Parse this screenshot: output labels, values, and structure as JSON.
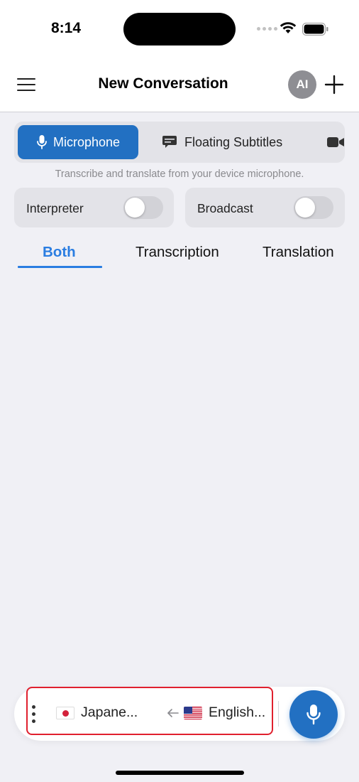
{
  "status_bar": {
    "time": "8:14"
  },
  "nav": {
    "title": "New Conversation",
    "avatar_initials": "AI",
    "menu_icon": "hamburger-menu-icon",
    "add_icon": "plus-icon"
  },
  "source_selector": {
    "items": [
      {
        "label": "Microphone",
        "icon": "microphone-icon",
        "selected": true
      },
      {
        "label": "Floating Subtitles",
        "icon": "subtitles-icon",
        "selected": false
      },
      {
        "label": "",
        "icon": "video-camera-icon",
        "selected": false
      }
    ],
    "description": "Transcribe and translate from your device microphone."
  },
  "toggles": [
    {
      "label": "Interpreter",
      "on": false
    },
    {
      "label": "Broadcast",
      "on": false
    }
  ],
  "tabs": [
    {
      "label": "Both",
      "active": true
    },
    {
      "label": "Transcription",
      "active": false
    },
    {
      "label": "Translation",
      "active": false
    }
  ],
  "language_bar": {
    "source_language": "Japane...",
    "source_flag": "japan-flag-icon",
    "direction_icon": "arrow-left-icon",
    "target_language": "English...",
    "target_flag": "us-flag-icon",
    "more_icon": "vertical-dots-icon",
    "record_icon": "microphone-icon"
  },
  "colors": {
    "accent": "#2270c2",
    "tab_active": "#2a7de1",
    "highlight_border": "#e0202e",
    "background": "#f0f0f5"
  }
}
